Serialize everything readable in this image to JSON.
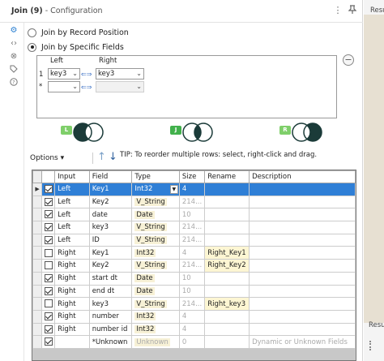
{
  "window": {
    "title_tool": "Join (9)",
    "title_sep": " - ",
    "title_section": "Configuration"
  },
  "left_icons": [
    "gear-icon",
    "code-icon",
    "tag-cross-icon",
    "tag-icon",
    "help-icon"
  ],
  "join_mode": {
    "option_position": "Join by Record Position",
    "option_fields": "Join by Specific Fields",
    "selected": "fields"
  },
  "join_fields": {
    "header_left": "Left",
    "header_right": "Right",
    "rows": [
      {
        "num": "1",
        "left": "key3",
        "right": "key3"
      },
      {
        "num": "*",
        "left": "",
        "right": ""
      }
    ]
  },
  "venn": [
    {
      "badge": "L",
      "fill": "left-only"
    },
    {
      "badge": "J",
      "fill": "inner"
    },
    {
      "badge": "R",
      "fill": "right-only"
    }
  ],
  "toolbar": {
    "options_label": "Options",
    "options_caret": "▾",
    "tip": "TIP: To reorder multiple rows: select, right-click and drag."
  },
  "grid": {
    "columns": [
      "Input",
      "Field",
      "Type",
      "Size",
      "Rename",
      "Description"
    ],
    "rows": [
      {
        "checked": true,
        "input": "Left",
        "field": "Key1",
        "type": "Int32",
        "size": "4",
        "rename": "",
        "description": "",
        "selected": true
      },
      {
        "checked": true,
        "input": "Left",
        "field": "Key2",
        "type": "V_String",
        "size": "214...",
        "rename": "",
        "description": ""
      },
      {
        "checked": true,
        "input": "Left",
        "field": "date",
        "type": "Date",
        "size": "10",
        "rename": "",
        "description": ""
      },
      {
        "checked": true,
        "input": "Left",
        "field": "key3",
        "type": "V_String",
        "size": "214...",
        "rename": "",
        "description": ""
      },
      {
        "checked": true,
        "input": "Left",
        "field": "ID",
        "type": "V_String",
        "size": "214...",
        "rename": "",
        "description": ""
      },
      {
        "checked": false,
        "input": "Right",
        "field": "Key1",
        "type": "Int32",
        "size": "4",
        "rename": "Right_Key1",
        "description": ""
      },
      {
        "checked": false,
        "input": "Right",
        "field": "Key2",
        "type": "V_String",
        "size": "214...",
        "rename": "Right_Key2",
        "description": ""
      },
      {
        "checked": true,
        "input": "Right",
        "field": "start dt",
        "type": "Date",
        "size": "10",
        "rename": "",
        "description": ""
      },
      {
        "checked": true,
        "input": "Right",
        "field": "end dt",
        "type": "Date",
        "size": "10",
        "rename": "",
        "description": ""
      },
      {
        "checked": false,
        "input": "Right",
        "field": "key3",
        "type": "V_String",
        "size": "214...",
        "rename": "Right_key3",
        "description": ""
      },
      {
        "checked": true,
        "input": "Right",
        "field": "number",
        "type": "Int32",
        "size": "4",
        "rename": "",
        "description": ""
      },
      {
        "checked": true,
        "input": "Right",
        "field": "number id",
        "type": "Int32",
        "size": "4",
        "rename": "",
        "description": ""
      },
      {
        "checked": true,
        "input": "",
        "field": "*Unknown",
        "type": "Unknown",
        "size": "0",
        "rename": "",
        "description": "Dynamic or Unknown Fields",
        "dim": true
      }
    ]
  },
  "side_panel": {
    "top_text": "Resu",
    "bottom_text": "Resu"
  },
  "colors": {
    "selection": "#2f7fd6",
    "venn_dark": "#1b3b39",
    "badge_green": "#42b14c"
  }
}
